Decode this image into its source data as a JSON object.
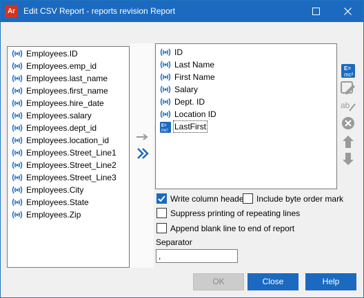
{
  "window": {
    "app_icon_text": "Ar",
    "title": "Edit CSV Report - reports revision Report"
  },
  "available_fields": [
    {
      "label": "Employees.ID"
    },
    {
      "label": "Employees.emp_id"
    },
    {
      "label": "Employees.last_name"
    },
    {
      "label": "Employees.first_name"
    },
    {
      "label": "Employees.hire_date"
    },
    {
      "label": "Employees.salary"
    },
    {
      "label": "Employees.dept_id"
    },
    {
      "label": "Employees.location_id"
    },
    {
      "label": "Employees.Street_Line1"
    },
    {
      "label": "Employees.Street_Line2"
    },
    {
      "label": "Employees.Street_Line3"
    },
    {
      "label": "Employees.City"
    },
    {
      "label": "Employees.State"
    },
    {
      "label": "Employees.Zip"
    }
  ],
  "report_columns": [
    {
      "label": "ID",
      "icon": "field-icon"
    },
    {
      "label": "Last Name",
      "icon": "field-icon"
    },
    {
      "label": "First Name",
      "icon": "field-icon"
    },
    {
      "label": "Salary",
      "icon": "field-icon"
    },
    {
      "label": "Dept. ID",
      "icon": "field-icon"
    },
    {
      "label": "Location ID",
      "icon": "field-icon"
    },
    {
      "label": "LastFirst",
      "icon": "formula-icon",
      "selected": true
    }
  ],
  "options": {
    "write_column_header": {
      "label": "Write column header",
      "checked": true
    },
    "include_byte_order_mark": {
      "label": "Include byte order mark",
      "checked": false
    },
    "suppress_repeating": {
      "label": "Suppress printing of repeating lines",
      "checked": false
    },
    "append_blank_line": {
      "label": "Append blank line to end of report",
      "checked": false
    }
  },
  "separator": {
    "label": "Separator",
    "value": ","
  },
  "buttons": {
    "ok": "OK",
    "close": "Close",
    "help": "Help"
  },
  "colors": {
    "accent": "#1b6ac0",
    "field_icon": "#1b6ac0",
    "disabled": "#9a9a9a"
  }
}
